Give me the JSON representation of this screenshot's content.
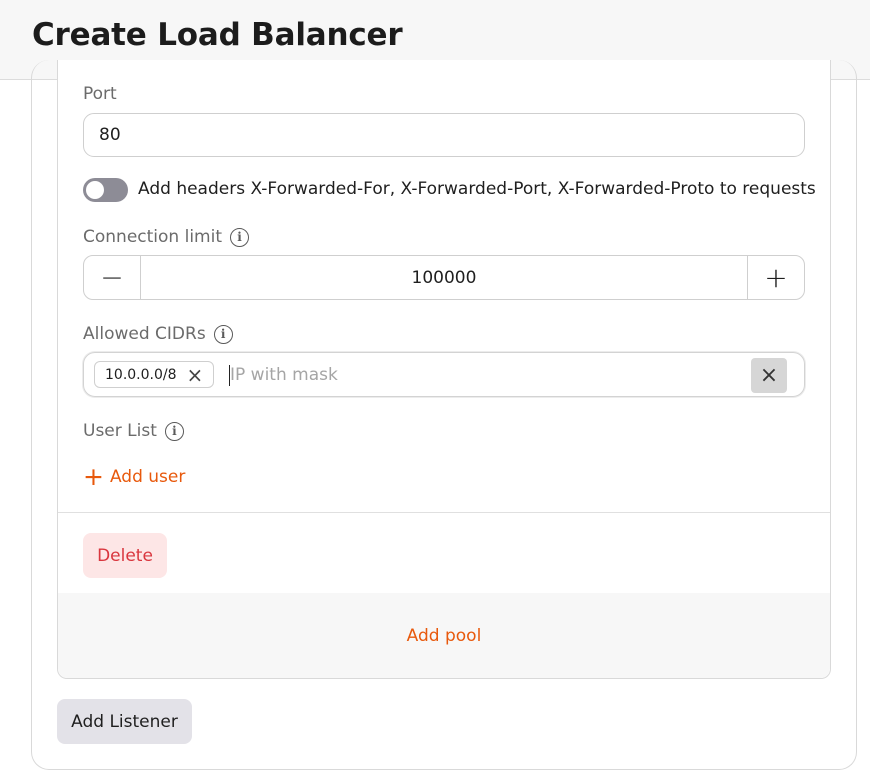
{
  "header": {
    "title": "Create Load Balancer"
  },
  "listener": {
    "port": {
      "label": "Port",
      "value": "80"
    },
    "headers_toggle": {
      "label": "Add headers X-Forwarded-For, X-Forwarded-Port, X-Forwarded-Proto to requests",
      "enabled": false
    },
    "connection_limit": {
      "label": "Connection limit",
      "value": "100000",
      "decrement": "−",
      "increment": "+"
    },
    "allowed_cidrs": {
      "label": "Allowed CIDRs",
      "chips": [
        "10.0.0.0/8"
      ],
      "placeholder": "IP with mask"
    },
    "user_list": {
      "label": "User List",
      "add_label": "Add user"
    },
    "delete_label": "Delete",
    "add_pool_label": "Add pool"
  },
  "add_listener_label": "Add Listener",
  "colors": {
    "accent": "#e8590c",
    "danger": "#d9363e",
    "danger_bg": "#fde6e6"
  }
}
